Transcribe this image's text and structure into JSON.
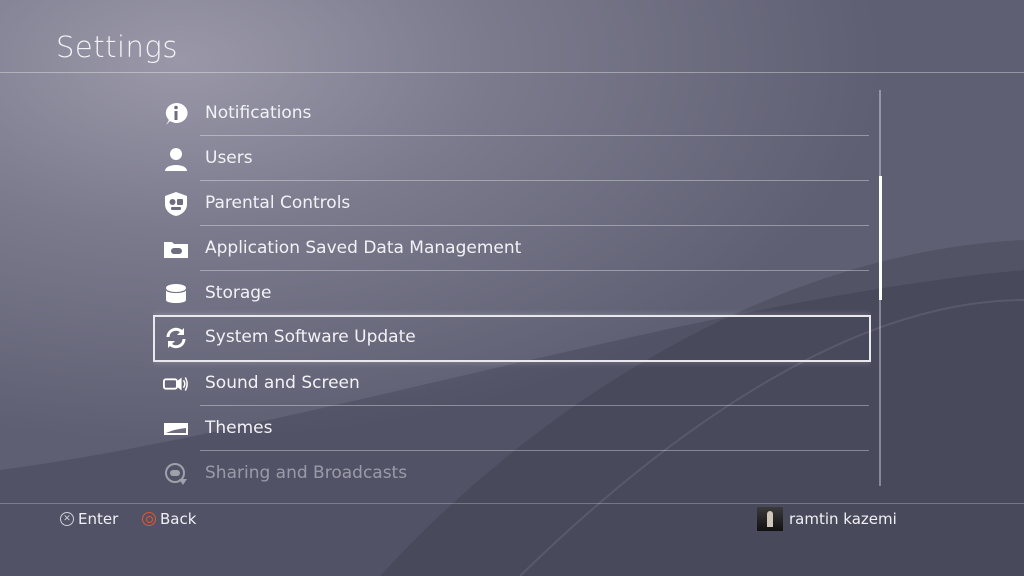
{
  "header": {
    "title": "Settings"
  },
  "menu": {
    "items": [
      {
        "label": "Notifications",
        "icon": "info-bubble-icon"
      },
      {
        "label": "Users",
        "icon": "user-icon"
      },
      {
        "label": "Parental Controls",
        "icon": "parental-shield-icon"
      },
      {
        "label": "Application Saved Data Management",
        "icon": "saved-data-folder-icon"
      },
      {
        "label": "Storage",
        "icon": "storage-cylinder-icon"
      },
      {
        "label": "System Software Update",
        "icon": "update-arrows-icon",
        "selected": true
      },
      {
        "label": "Sound and Screen",
        "icon": "sound-screen-icon"
      },
      {
        "label": "Themes",
        "icon": "themes-icon"
      },
      {
        "label": "Sharing and Broadcasts",
        "icon": "sharing-icon"
      }
    ]
  },
  "footer": {
    "enter_label": "Enter",
    "back_label": "Back",
    "user_name": "ramtin kazemi"
  },
  "colors": {
    "background": "#6e6d80",
    "text": "#f2f2f6",
    "back_button": "#e8542a"
  }
}
